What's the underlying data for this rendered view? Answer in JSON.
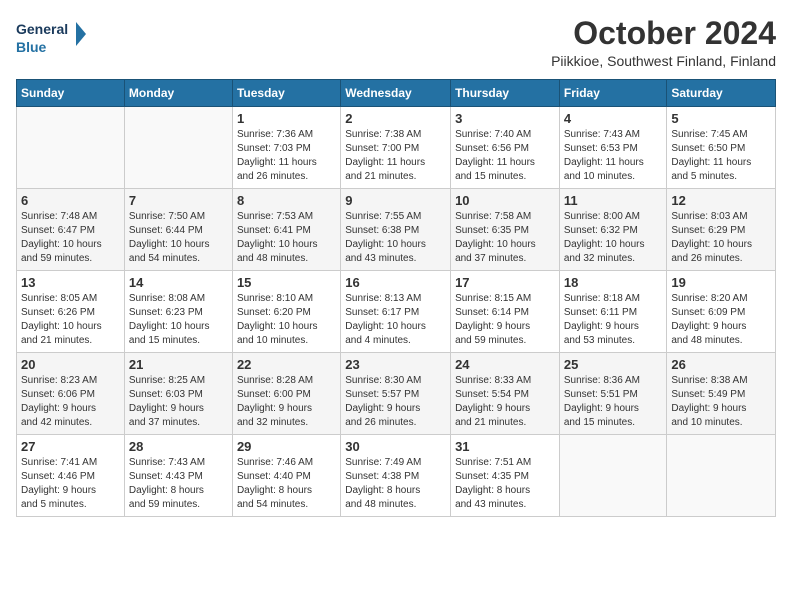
{
  "header": {
    "logo_line1": "General",
    "logo_line2": "Blue",
    "month": "October 2024",
    "location": "Piikkioe, Southwest Finland, Finland"
  },
  "days_of_week": [
    "Sunday",
    "Monday",
    "Tuesday",
    "Wednesday",
    "Thursday",
    "Friday",
    "Saturday"
  ],
  "weeks": [
    [
      {
        "day": "",
        "details": ""
      },
      {
        "day": "",
        "details": ""
      },
      {
        "day": "1",
        "details": "Sunrise: 7:36 AM\nSunset: 7:03 PM\nDaylight: 11 hours\nand 26 minutes."
      },
      {
        "day": "2",
        "details": "Sunrise: 7:38 AM\nSunset: 7:00 PM\nDaylight: 11 hours\nand 21 minutes."
      },
      {
        "day": "3",
        "details": "Sunrise: 7:40 AM\nSunset: 6:56 PM\nDaylight: 11 hours\nand 15 minutes."
      },
      {
        "day": "4",
        "details": "Sunrise: 7:43 AM\nSunset: 6:53 PM\nDaylight: 11 hours\nand 10 minutes."
      },
      {
        "day": "5",
        "details": "Sunrise: 7:45 AM\nSunset: 6:50 PM\nDaylight: 11 hours\nand 5 minutes."
      }
    ],
    [
      {
        "day": "6",
        "details": "Sunrise: 7:48 AM\nSunset: 6:47 PM\nDaylight: 10 hours\nand 59 minutes."
      },
      {
        "day": "7",
        "details": "Sunrise: 7:50 AM\nSunset: 6:44 PM\nDaylight: 10 hours\nand 54 minutes."
      },
      {
        "day": "8",
        "details": "Sunrise: 7:53 AM\nSunset: 6:41 PM\nDaylight: 10 hours\nand 48 minutes."
      },
      {
        "day": "9",
        "details": "Sunrise: 7:55 AM\nSunset: 6:38 PM\nDaylight: 10 hours\nand 43 minutes."
      },
      {
        "day": "10",
        "details": "Sunrise: 7:58 AM\nSunset: 6:35 PM\nDaylight: 10 hours\nand 37 minutes."
      },
      {
        "day": "11",
        "details": "Sunrise: 8:00 AM\nSunset: 6:32 PM\nDaylight: 10 hours\nand 32 minutes."
      },
      {
        "day": "12",
        "details": "Sunrise: 8:03 AM\nSunset: 6:29 PM\nDaylight: 10 hours\nand 26 minutes."
      }
    ],
    [
      {
        "day": "13",
        "details": "Sunrise: 8:05 AM\nSunset: 6:26 PM\nDaylight: 10 hours\nand 21 minutes."
      },
      {
        "day": "14",
        "details": "Sunrise: 8:08 AM\nSunset: 6:23 PM\nDaylight: 10 hours\nand 15 minutes."
      },
      {
        "day": "15",
        "details": "Sunrise: 8:10 AM\nSunset: 6:20 PM\nDaylight: 10 hours\nand 10 minutes."
      },
      {
        "day": "16",
        "details": "Sunrise: 8:13 AM\nSunset: 6:17 PM\nDaylight: 10 hours\nand 4 minutes."
      },
      {
        "day": "17",
        "details": "Sunrise: 8:15 AM\nSunset: 6:14 PM\nDaylight: 9 hours\nand 59 minutes."
      },
      {
        "day": "18",
        "details": "Sunrise: 8:18 AM\nSunset: 6:11 PM\nDaylight: 9 hours\nand 53 minutes."
      },
      {
        "day": "19",
        "details": "Sunrise: 8:20 AM\nSunset: 6:09 PM\nDaylight: 9 hours\nand 48 minutes."
      }
    ],
    [
      {
        "day": "20",
        "details": "Sunrise: 8:23 AM\nSunset: 6:06 PM\nDaylight: 9 hours\nand 42 minutes."
      },
      {
        "day": "21",
        "details": "Sunrise: 8:25 AM\nSunset: 6:03 PM\nDaylight: 9 hours\nand 37 minutes."
      },
      {
        "day": "22",
        "details": "Sunrise: 8:28 AM\nSunset: 6:00 PM\nDaylight: 9 hours\nand 32 minutes."
      },
      {
        "day": "23",
        "details": "Sunrise: 8:30 AM\nSunset: 5:57 PM\nDaylight: 9 hours\nand 26 minutes."
      },
      {
        "day": "24",
        "details": "Sunrise: 8:33 AM\nSunset: 5:54 PM\nDaylight: 9 hours\nand 21 minutes."
      },
      {
        "day": "25",
        "details": "Sunrise: 8:36 AM\nSunset: 5:51 PM\nDaylight: 9 hours\nand 15 minutes."
      },
      {
        "day": "26",
        "details": "Sunrise: 8:38 AM\nSunset: 5:49 PM\nDaylight: 9 hours\nand 10 minutes."
      }
    ],
    [
      {
        "day": "27",
        "details": "Sunrise: 7:41 AM\nSunset: 4:46 PM\nDaylight: 9 hours\nand 5 minutes."
      },
      {
        "day": "28",
        "details": "Sunrise: 7:43 AM\nSunset: 4:43 PM\nDaylight: 8 hours\nand 59 minutes."
      },
      {
        "day": "29",
        "details": "Sunrise: 7:46 AM\nSunset: 4:40 PM\nDaylight: 8 hours\nand 54 minutes."
      },
      {
        "day": "30",
        "details": "Sunrise: 7:49 AM\nSunset: 4:38 PM\nDaylight: 8 hours\nand 48 minutes."
      },
      {
        "day": "31",
        "details": "Sunrise: 7:51 AM\nSunset: 4:35 PM\nDaylight: 8 hours\nand 43 minutes."
      },
      {
        "day": "",
        "details": ""
      },
      {
        "day": "",
        "details": ""
      }
    ]
  ]
}
